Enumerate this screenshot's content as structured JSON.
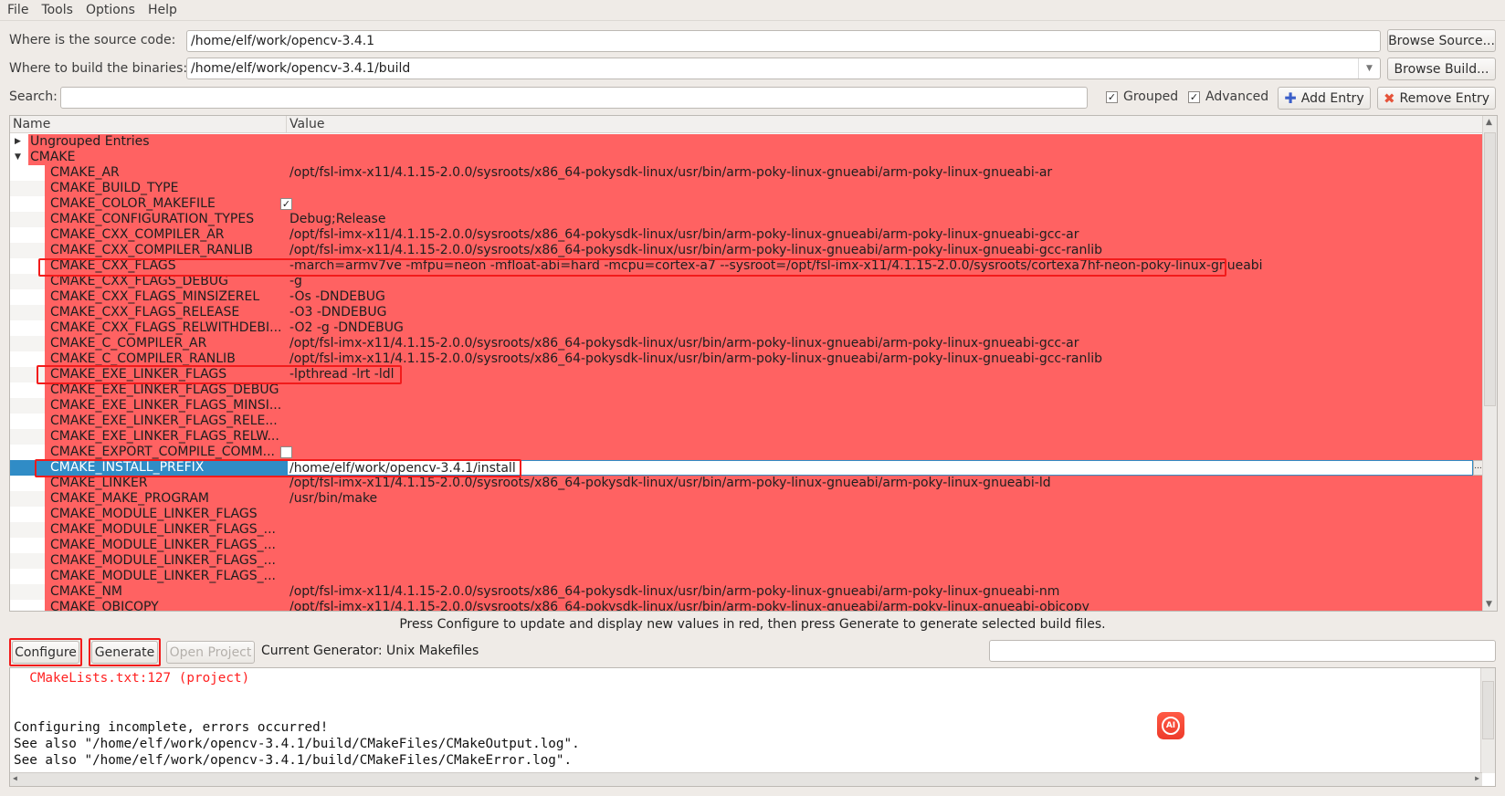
{
  "menu": [
    "File",
    "Tools",
    "Options",
    "Help"
  ],
  "source": {
    "label": "Where is the source code:",
    "value": "/home/elf/work/opencv-3.4.1",
    "browse": "Browse Source..."
  },
  "build": {
    "label": "Where to build the binaries:",
    "value": "/home/elf/work/opencv-3.4.1/build",
    "browse": "Browse Build..."
  },
  "search": {
    "label": "Search:",
    "value": ""
  },
  "options": {
    "grouped": {
      "label": "Grouped",
      "checked": true
    },
    "advanced": {
      "label": "Advanced",
      "checked": true
    }
  },
  "add_entry": "Add Entry",
  "remove_entry": "Remove Entry",
  "table": {
    "headers": [
      "Name",
      "Value"
    ],
    "groups": [
      {
        "name": "Ungrouped Entries",
        "expanded": false
      },
      {
        "name": "CMAKE",
        "expanded": true
      }
    ],
    "entries": [
      {
        "name": "CMAKE_AR",
        "value": "/opt/fsl-imx-x11/4.1.15-2.0.0/sysroots/x86_64-pokysdk-linux/usr/bin/arm-poky-linux-gnueabi/arm-poky-linux-gnueabi-ar"
      },
      {
        "name": "CMAKE_BUILD_TYPE",
        "value": ""
      },
      {
        "name": "CMAKE_COLOR_MAKEFILE",
        "type": "bool",
        "checked": true
      },
      {
        "name": "CMAKE_CONFIGURATION_TYPES",
        "value": "Debug;Release"
      },
      {
        "name": "CMAKE_CXX_COMPILER_AR",
        "value": "/opt/fsl-imx-x11/4.1.15-2.0.0/sysroots/x86_64-pokysdk-linux/usr/bin/arm-poky-linux-gnueabi/arm-poky-linux-gnueabi-gcc-ar"
      },
      {
        "name": "CMAKE_CXX_COMPILER_RANLIB",
        "value": "/opt/fsl-imx-x11/4.1.15-2.0.0/sysroots/x86_64-pokysdk-linux/usr/bin/arm-poky-linux-gnueabi/arm-poky-linux-gnueabi-gcc-ranlib"
      },
      {
        "name": "CMAKE_CXX_FLAGS",
        "value": "-march=armv7ve -mfpu=neon  -mfloat-abi=hard -mcpu=cortex-a7 --sysroot=/opt/fsl-imx-x11/4.1.15-2.0.0/sysroots/cortexa7hf-neon-poky-linux-gnueabi",
        "highlight": true
      },
      {
        "name": "CMAKE_CXX_FLAGS_DEBUG",
        "value": "-g"
      },
      {
        "name": "CMAKE_CXX_FLAGS_MINSIZEREL",
        "value": "-Os -DNDEBUG"
      },
      {
        "name": "CMAKE_CXX_FLAGS_RELEASE",
        "value": "-O3 -DNDEBUG"
      },
      {
        "name": "CMAKE_CXX_FLAGS_RELWITHDEBI...",
        "value": "-O2 -g -DNDEBUG"
      },
      {
        "name": "CMAKE_C_COMPILER_AR",
        "value": "/opt/fsl-imx-x11/4.1.15-2.0.0/sysroots/x86_64-pokysdk-linux/usr/bin/arm-poky-linux-gnueabi/arm-poky-linux-gnueabi-gcc-ar"
      },
      {
        "name": "CMAKE_C_COMPILER_RANLIB",
        "value": "/opt/fsl-imx-x11/4.1.15-2.0.0/sysroots/x86_64-pokysdk-linux/usr/bin/arm-poky-linux-gnueabi/arm-poky-linux-gnueabi-gcc-ranlib"
      },
      {
        "name": "CMAKE_EXE_LINKER_FLAGS",
        "value": "-lpthread -lrt -ldl",
        "highlight": true
      },
      {
        "name": "CMAKE_EXE_LINKER_FLAGS_DEBUG",
        "value": ""
      },
      {
        "name": "CMAKE_EXE_LINKER_FLAGS_MINSI...",
        "value": ""
      },
      {
        "name": "CMAKE_EXE_LINKER_FLAGS_RELE...",
        "value": ""
      },
      {
        "name": "CMAKE_EXE_LINKER_FLAGS_RELW...",
        "value": ""
      },
      {
        "name": "CMAKE_EXPORT_COMPILE_COMM...",
        "type": "bool",
        "checked": false
      },
      {
        "name": "CMAKE_INSTALL_PREFIX",
        "value": "/home/elf/work/opencv-3.4.1/install",
        "selected": true,
        "editing": true,
        "highlight": true
      },
      {
        "name": "CMAKE_LINKER",
        "value": "/opt/fsl-imx-x11/4.1.15-2.0.0/sysroots/x86_64-pokysdk-linux/usr/bin/arm-poky-linux-gnueabi/arm-poky-linux-gnueabi-ld"
      },
      {
        "name": "CMAKE_MAKE_PROGRAM",
        "value": "/usr/bin/make"
      },
      {
        "name": "CMAKE_MODULE_LINKER_FLAGS",
        "value": ""
      },
      {
        "name": "CMAKE_MODULE_LINKER_FLAGS_...",
        "value": ""
      },
      {
        "name": "CMAKE_MODULE_LINKER_FLAGS_...",
        "value": ""
      },
      {
        "name": "CMAKE_MODULE_LINKER_FLAGS_...",
        "value": ""
      },
      {
        "name": "CMAKE_MODULE_LINKER_FLAGS_...",
        "value": ""
      },
      {
        "name": "CMAKE_NM",
        "value": "/opt/fsl-imx-x11/4.1.15-2.0.0/sysroots/x86_64-pokysdk-linux/usr/bin/arm-poky-linux-gnueabi/arm-poky-linux-gnueabi-nm"
      },
      {
        "name": "CMAKE_OBJCOPY",
        "value": "/opt/fsl-imx-x11/4.1.15-2.0.0/sysroots/x86_64-pokysdk-linux/usr/bin/arm-poky-linux-gnueabi/arm-poky-linux-gnueabi-objcopy"
      }
    ]
  },
  "status": "Press Configure to update and display new values in red, then press Generate to generate selected build files.",
  "buttons": {
    "configure": "Configure",
    "generate": "Generate",
    "open_project": "Open Project"
  },
  "generator": "Current Generator: Unix Makefiles",
  "output": {
    "lines": [
      {
        "text": "  CMakeLists.txt:127 (project)",
        "color": "#ff2020"
      },
      {
        "text": "Configuring incomplete, errors occurred!",
        "color": "#111111"
      },
      {
        "text": "See also \"/home/elf/work/opencv-3.4.1/build/CMakeFiles/CMakeOutput.log\".",
        "color": "#111111"
      },
      {
        "text": "See also \"/home/elf/work/opencv-3.4.1/build/CMakeFiles/CMakeError.log\".",
        "color": "#111111"
      }
    ]
  },
  "ai_badge": "AI",
  "colors": {
    "changed_row": "#ff6262",
    "selection": "#308cc6",
    "highlight_box": "#f21b1b"
  }
}
